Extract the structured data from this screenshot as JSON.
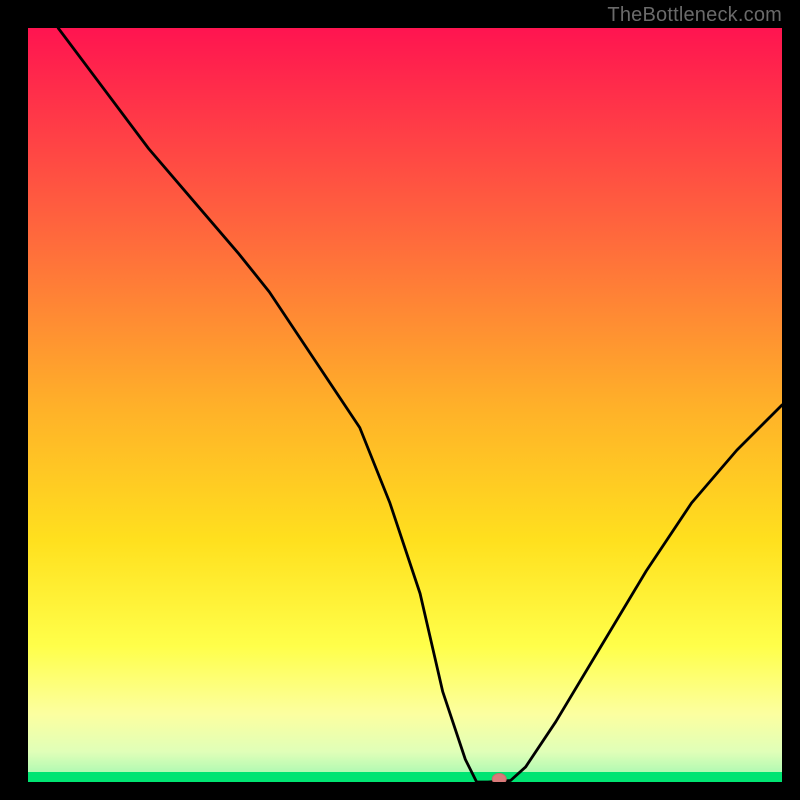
{
  "watermark": "TheBottleneck.com",
  "colors": {
    "frame": "#000000",
    "curve": "#000000",
    "green_band": "#00e472",
    "marker_fill": "#d97a7a",
    "marker_stroke": "#c96a6a",
    "gradient_top": "#ff1450",
    "gradient_mid1": "#ff7e3a",
    "gradient_mid2": "#ffd21a",
    "gradient_mid3": "#ffff5a",
    "gradient_low": "#f8ffb0"
  },
  "chart_data": {
    "type": "line",
    "title": "",
    "xlabel": "",
    "ylabel": "",
    "xlim": [
      0,
      100
    ],
    "ylim": [
      0,
      100
    ],
    "x": [
      0,
      4,
      10,
      16,
      22,
      28,
      32,
      38,
      44,
      48,
      52,
      55,
      58,
      59.5,
      61,
      64,
      66,
      70,
      76,
      82,
      88,
      94,
      100
    ],
    "values": [
      135,
      100,
      92,
      84,
      77,
      70,
      65,
      56,
      47,
      37,
      25,
      12,
      3,
      0,
      0,
      0.2,
      2,
      8,
      18,
      28,
      37,
      44,
      50
    ],
    "flat_region": {
      "x_start": 58,
      "x_end": 64,
      "y": 0
    },
    "marker": {
      "x": 62.5,
      "y": 0
    },
    "green_baseline_y": 0
  }
}
